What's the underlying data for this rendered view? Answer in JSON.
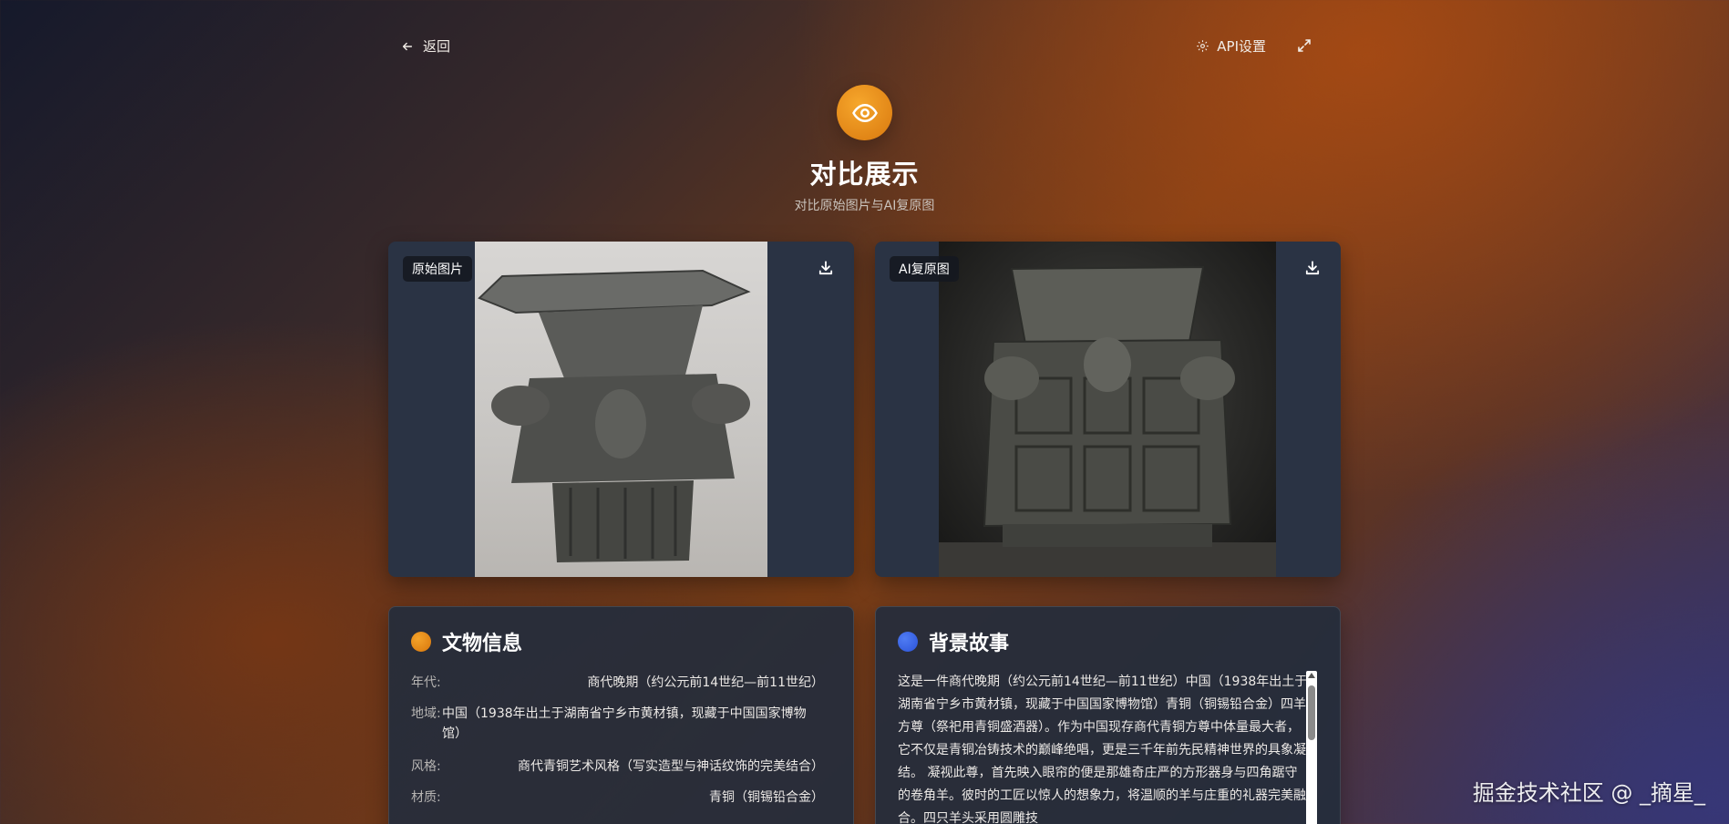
{
  "nav": {
    "back_label": "返回",
    "api_label": "API设置"
  },
  "header": {
    "title": "对比展示",
    "subtitle": "对比原始图片与AI复原图"
  },
  "images": {
    "original_badge": "原始图片",
    "restored_badge": "AI复原图"
  },
  "artifact": {
    "title": "文物信息",
    "fields": [
      {
        "key": "年代:",
        "value": "商代晚期（约公元前14世纪—前11世纪）"
      },
      {
        "key": "地域:",
        "value": "中国（1938年出土于湖南省宁乡市黄材镇，现藏于中国国家博物馆）"
      },
      {
        "key": "风格:",
        "value": "商代青铜艺术风格（写实造型与神话纹饰的完美结合）"
      },
      {
        "key": "材质:",
        "value": "青铜（铜锡铅合金）"
      }
    ]
  },
  "story": {
    "title": "背景故事",
    "text": "这是一件商代晚期（约公元前14世纪—前11世纪）中国（1938年出土于湖南省宁乡市黄材镇，现藏于中国国家博物馆）青铜（铜锡铅合金）四羊方尊（祭祀用青铜盛酒器）。作为中国现存商代青铜方尊中体量最大者，它不仅是青铜冶铸技术的巅峰绝唱，更是三千年前先民精神世界的具象凝结。 凝视此尊，首先映入眼帘的便是那雄奇庄严的方形器身与四角踞守的卷角羊。彼时的工匠以惊人的想象力，将温顺的羊与庄重的礼器完美融合。四只羊头采用圆雕技"
  },
  "watermark": "掘金技术社区 @ _摘星_",
  "colors": {
    "accent_orange": "#e8890f",
    "accent_blue": "#3b66e6"
  }
}
